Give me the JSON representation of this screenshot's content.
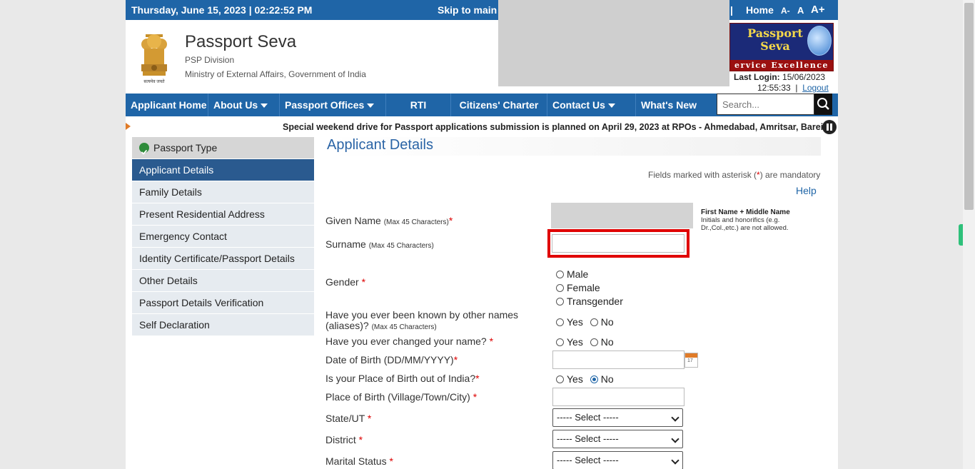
{
  "topbar": {
    "date": "Thursday,  June  15, 2023 | 02:22:52 PM",
    "skip": "Skip to main c",
    "separator": "|",
    "home": "Home",
    "font_small": "A-",
    "font_normal": "A",
    "font_large": "A+"
  },
  "header": {
    "title": "Passport Seva",
    "division": "PSP Division",
    "ministry": "Ministry of External Affairs, Government of India",
    "emblem_caption": "सत्यमेव जयते",
    "logo_line1": "Passport",
    "logo_line2": "Seva",
    "logo_tag": "ervice Excellence",
    "last_login_label": "Last Login:",
    "last_login_date": "15/06/2023",
    "last_login_time": "12:55:33",
    "time_sep": "|",
    "logout": "Logout"
  },
  "nav": {
    "items": [
      {
        "label": "Applicant Home"
      },
      {
        "label": "About Us"
      },
      {
        "label": "Passport Offices"
      },
      {
        "label": "RTI"
      },
      {
        "label": "Citizens' Charter"
      },
      {
        "label": "Contact Us"
      },
      {
        "label": "What's New"
      }
    ],
    "search_placeholder": "Search..."
  },
  "ticker": {
    "text": "Special weekend drive for Passport applications submission is planned on April 29, 2023 at RPOs - Ahmedabad, Amritsar, Bareilly,"
  },
  "sidebar": {
    "items": [
      {
        "label": "Passport Type"
      },
      {
        "label": "Applicant Details"
      },
      {
        "label": "Family Details"
      },
      {
        "label": "Present Residential Address"
      },
      {
        "label": "Emergency Contact"
      },
      {
        "label": "Identity Certificate/Passport Details"
      },
      {
        "label": "Other Details"
      },
      {
        "label": "Passport Details Verification"
      },
      {
        "label": "Self Declaration"
      }
    ]
  },
  "main": {
    "title": "Applicant Details",
    "mandatory_pre": "Fields marked with asterisk (",
    "mandatory_ast": "*",
    "mandatory_post": ") are mandatory",
    "help": "Help",
    "asterisk": "*",
    "max45": "(Max 45 Characters)",
    "given_name": "Given Name",
    "given_hint_bold": "First Name + Middle Name",
    "given_hint": "Initials and honorifics (e.g. Dr.,Col.,etc.) are not allowed.",
    "surname": "Surname",
    "gender": "Gender",
    "gender_options": [
      "Male",
      "Female",
      "Transgender"
    ],
    "aliases_line1": "Have you ever been known by other names",
    "aliases_line2": "(aliases)?",
    "changed_name": "Have you ever changed your name?",
    "dob": "Date of Birth (DD/MM/YYYY)",
    "cal_day": "17",
    "pob_out": "Is your Place of Birth out of India?",
    "pob": "Place of Birth (Village/Town/City)",
    "state": "State/UT",
    "district": "District",
    "marital": "Marital Status",
    "yes": "Yes",
    "no": "No",
    "select_placeholder": "----- Select -----"
  }
}
